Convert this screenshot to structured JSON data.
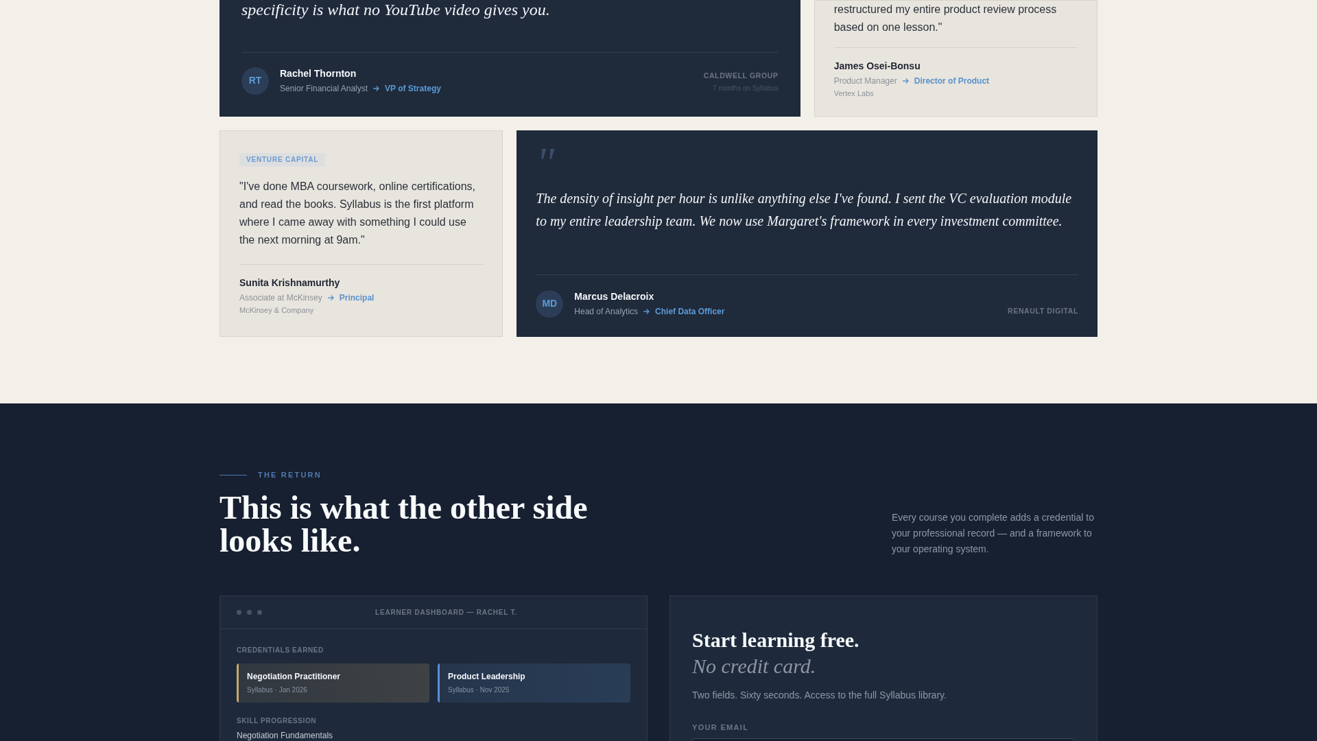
{
  "testimonials": [
    {
      "kind": "featured",
      "quote": "specificity is what no YouTube video gives you.",
      "initials": "RT",
      "name": "Rachel Thornton",
      "role_from": "Senior Financial Analyst",
      "role_to": "VP of Strategy",
      "company": "CALDWELL GROUP",
      "tenure": "7 months on Syllabus"
    },
    {
      "kind": "light",
      "quote": "restructured my entire product review process based on one lesson.\"",
      "name": "James Osei-Bonsu",
      "role_from": "Product Manager",
      "role_to": "Director of Product",
      "company": "Vertex Labs"
    },
    {
      "kind": "light",
      "tag": "VENTURE CAPITAL",
      "quote": "\"I've done MBA coursework, online certifications, and read the books. Syllabus is the first platform where I came away with something I could use the next morning at 9am.\"",
      "name": "Sunita Krishnamurthy",
      "role_from": "Associate at McKinsey",
      "role_to": "Principal",
      "company": "McKinsey & Company"
    },
    {
      "kind": "dark",
      "quote_mark": "\"",
      "quote": "The density of insight per hour is unlike anything else I've found. I sent the VC evaluation module to my entire leadership team. We now use Margaret's framework in every investment committee.",
      "initials": "MD",
      "name": "Marcus Delacroix",
      "role_from": "Head of Analytics",
      "role_to": "Chief Data Officer",
      "company": "RENAULT DIGITAL"
    }
  ],
  "return_section": {
    "eyebrow": "THE RETURN",
    "heading": "This is what the other side looks like.",
    "intro": "Every course you complete adds a credential to your professional record — and a framework to your operating system."
  },
  "dashboard": {
    "title": "LEARNER DASHBOARD — RACHEL T.",
    "credentials_label": "CREDENTIALS EARNED",
    "credentials": [
      {
        "name": "Negotiation Practitioner",
        "meta": "Syllabus · Jan 2026",
        "color": "#c9a86a"
      },
      {
        "name": "Product Leadership",
        "meta": "Syllabus · Nov 2025",
        "color": "#5b8fd0"
      }
    ],
    "skills_label": "SKILL PROGRESSION",
    "skills": [
      {
        "name": "Negotiation Fundamentals"
      }
    ]
  },
  "signup": {
    "title": "Start learning free.",
    "subtitle": "No credit card.",
    "description": "Two fields. Sixty seconds. Access to the full Syllabus library.",
    "fields": [
      {
        "label": "YOUR EMAIL"
      }
    ]
  }
}
